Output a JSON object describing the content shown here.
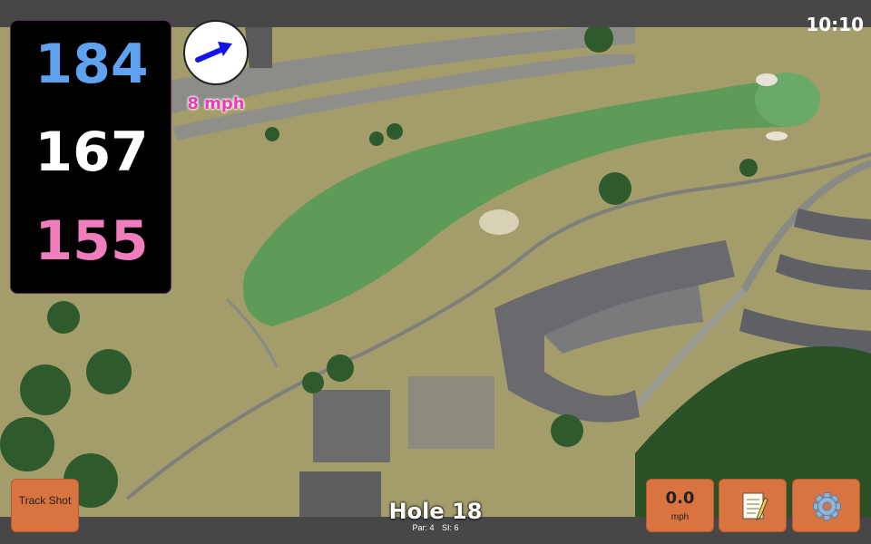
{
  "status": {
    "time": "10:10"
  },
  "distances": {
    "back": "184",
    "center": "167",
    "front": "155"
  },
  "wind": {
    "speed": "8 mph",
    "icon": "wind-arrow-icon"
  },
  "hole": {
    "title": "Hole 18",
    "par": "Par: 4",
    "si": "SI: 6"
  },
  "buttons": {
    "track_shot": "Track Shot",
    "speed_value": "0.0",
    "speed_unit": "mph",
    "notes_icon": "notepad-icon",
    "settings_icon": "gear-icon"
  },
  "colors": {
    "back": "#5ea2f0",
    "center": "#ffffff",
    "front": "#f07dbd",
    "button": "#d9733f",
    "wind_speed": "#e63fb0"
  }
}
